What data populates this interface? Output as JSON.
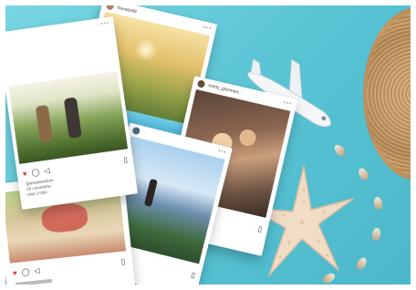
{
  "colors": {
    "background": "#5cc6d6",
    "card": "#ffffff",
    "straw": "#c9a06a",
    "starfish": "#f1dcc6",
    "airplane": "#f4f6f8",
    "like": "#e03b4b"
  },
  "cards": [
    {
      "username": "",
      "like_icon": "heart-icon"
    },
    {
      "username": "travelpi88"
    },
    {
      "username": "marty_grennies"
    },
    {
      "username": ""
    },
    {
      "username": ""
    }
  ],
  "captions": {
    "card1_line1": "@emailrandom",
    "card1_line2": "25 comments",
    "card1_line3": "Visit 3 trips"
  }
}
